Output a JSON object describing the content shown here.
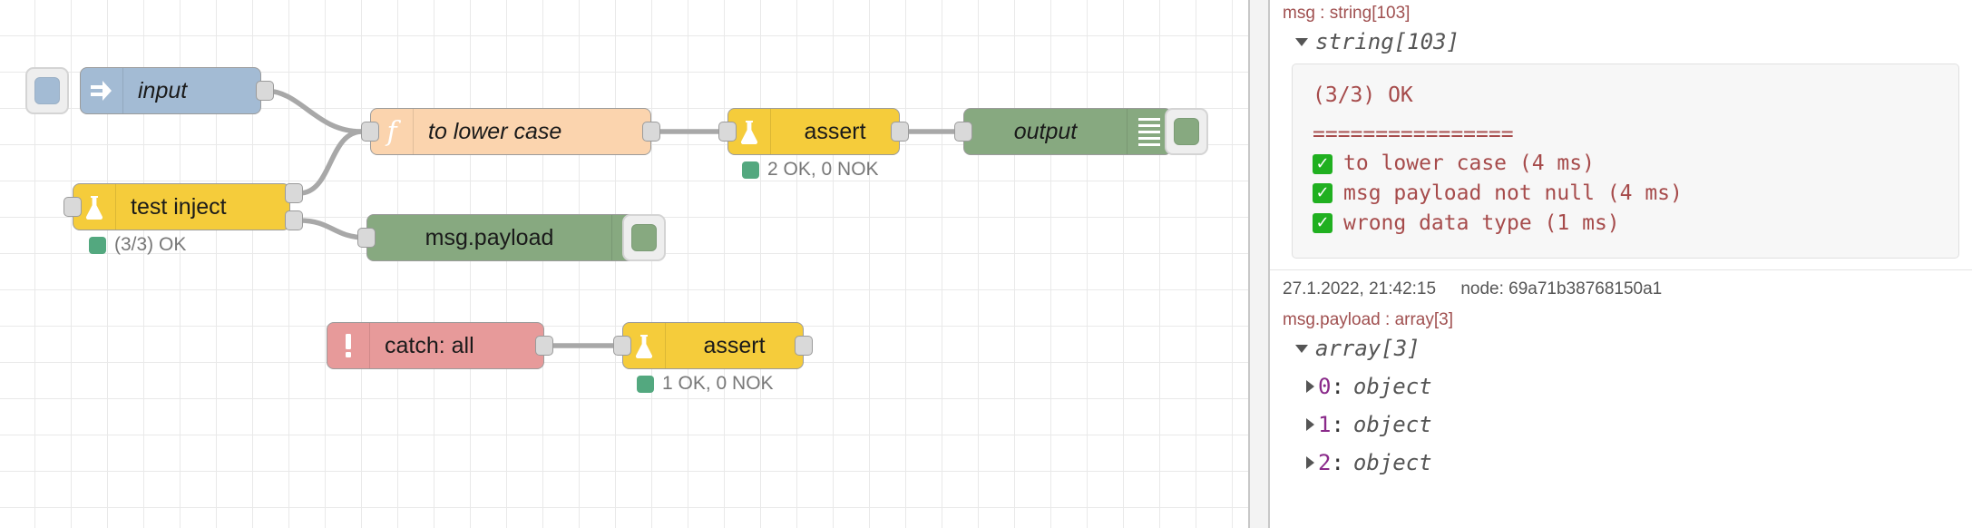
{
  "app": "node-red-flow-editor",
  "canvas": {
    "grid_color": "#e9e9e9",
    "nodes": [
      {
        "id": "link-in",
        "name": "input",
        "type": "link-in",
        "icon": "arrow-right-icon",
        "color": "#a3bbd4",
        "has_link_button": true
      },
      {
        "id": "test-inject",
        "name": "test inject",
        "type": "inject-test",
        "icon": "flask-icon",
        "color": "#f5cc3b",
        "status": "(3/3) OK",
        "status_color": "#53a87f"
      },
      {
        "id": "function-lowercase",
        "name": "to lower case",
        "type": "function",
        "icon": "function-f-icon",
        "color": "#fbd4ae"
      },
      {
        "id": "assert-top",
        "name": "assert",
        "type": "assert",
        "icon": "flask-icon",
        "color": "#f5cc3b",
        "status": "2 OK, 0 NOK",
        "status_color": "#53a87f"
      },
      {
        "id": "link-out",
        "name": "output",
        "type": "debug-link-out",
        "icon": "debug-lines-icon",
        "color": "#87a980",
        "has_debug_button": true
      },
      {
        "id": "debug-payload",
        "name": "msg.payload",
        "type": "debug",
        "icon": "debug-lines-icon",
        "color": "#87a980",
        "has_debug_button": true
      },
      {
        "id": "catch-all",
        "name": "catch: all",
        "type": "catch",
        "icon": "exclamation-icon",
        "color": "#e79a9a"
      },
      {
        "id": "assert-bottom",
        "name": "assert",
        "type": "assert",
        "icon": "flask-icon",
        "color": "#f5cc3b",
        "status": "1 OK, 0 NOK",
        "status_color": "#53a87f"
      }
    ]
  },
  "sidebar": {
    "messages": [
      {
        "id": "msg-1",
        "topic": "msg : string[103]",
        "type_label": "string[103]",
        "expanded": true,
        "string_lines": [
          {
            "text": "(3/3) OK",
            "check": false,
            "spaced": true
          },
          {
            "text": "================",
            "check": false,
            "spaced": false
          },
          {
            "text": "to lower case (4 ms)",
            "check": true,
            "spaced": false
          },
          {
            "text": "msg payload not null (4 ms)",
            "check": true,
            "spaced": false
          },
          {
            "text": "wrong data type (1 ms)",
            "check": true,
            "spaced": false
          }
        ]
      },
      {
        "id": "msg-2",
        "timestamp": "27.1.2022, 21:42:15",
        "node_label": "node: 69a71b38768150a1",
        "topic": "msg.payload : array[3]",
        "type_label": "array[3]",
        "expanded": true,
        "items": [
          {
            "key": "0",
            "colon": ":",
            "value": "object"
          },
          {
            "key": "1",
            "colon": ":",
            "value": "object"
          },
          {
            "key": "2",
            "colon": ":",
            "value": "object"
          }
        ]
      }
    ],
    "check_glyph": "✓",
    "colors": {
      "topic": "#a05050",
      "string": "#a64b4b",
      "key": "#8a2a8a",
      "type": "#555555",
      "check_bg": "#20b020"
    }
  }
}
